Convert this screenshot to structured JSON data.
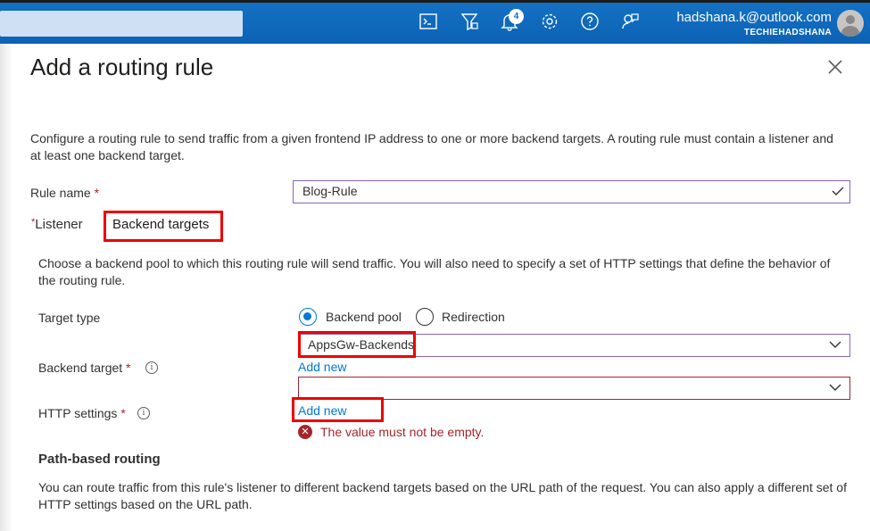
{
  "topbar": {
    "notification_count": "4",
    "account_email": "hadshana.k@outlook.com",
    "account_tenant": "TECHIEHADSHANA",
    "icons": [
      "cloud-shell-icon",
      "directory-filter-icon",
      "notifications-icon",
      "settings-icon",
      "help-icon",
      "feedback-icon"
    ]
  },
  "panel": {
    "title": "Add a routing rule",
    "description": "Configure a routing rule to send traffic from a given frontend IP address to one or more backend targets. A routing rule must contain a listener and at least one backend target.",
    "rule_name_label": "Rule name",
    "rule_name_value": "Blog-Rule",
    "tabs": {
      "listener": "Listener",
      "backend_targets": "Backend targets"
    },
    "backend": {
      "description": "Choose a backend pool to which this routing rule will send traffic. You will also need to specify a set of HTTP settings that define the behavior of the routing rule.",
      "target_type_label": "Target type",
      "target_type_options": [
        "Backend pool",
        "Redirection"
      ],
      "target_type_selected": "Backend pool",
      "backend_target_label": "Backend target",
      "backend_target_value": "AppsGw-Backends",
      "add_new_backend": "Add new",
      "http_settings_label": "HTTP settings",
      "http_settings_value": "",
      "add_new_http": "Add new",
      "error_message": "The value must not be empty."
    },
    "path_routing": {
      "heading": "Path-based routing",
      "description": "You can route traffic from this rule's listener to different backend targets based on the URL path of the request. You can also apply a different set of HTTP settings based on the URL path."
    }
  },
  "colors": {
    "topbar": "#0f6cbd",
    "link": "#0078d4",
    "error": "#a4262c",
    "input_focus": "#8764b8",
    "highlight": "#e00000"
  }
}
